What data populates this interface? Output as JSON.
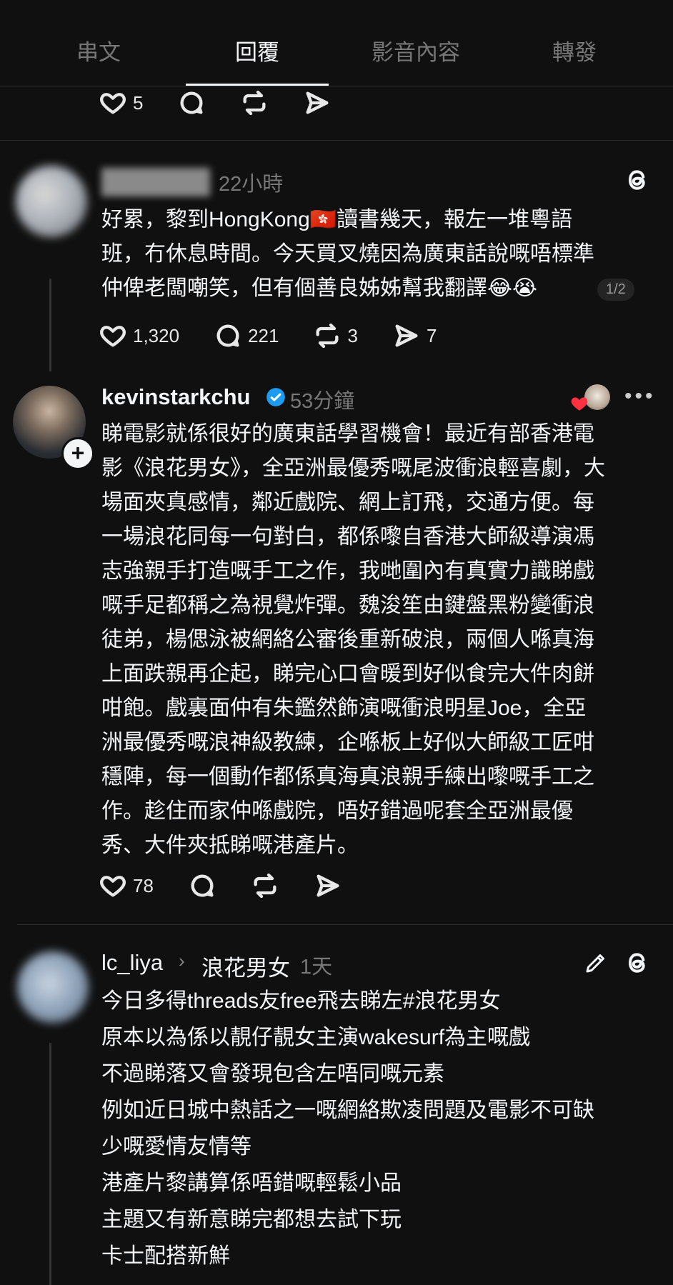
{
  "tabs": [
    "串文",
    "回覆",
    "影音內容",
    "轉發"
  ],
  "top_actions": {
    "likes": "5"
  },
  "post1": {
    "time": "22小時",
    "text": "好累，黎到HongKong🇭🇰讀書幾天，報左一堆粵語\n班，冇休息時間。今天買叉燒因為廣東話說嘅唔標準\n仲俾老闆嘲笑，但有個善良姊姊幫我翻譯😂😭",
    "pager": "1/2",
    "likes": "1,320",
    "replies": "221",
    "reposts": "3",
    "shares": "7"
  },
  "post2": {
    "username": "kevinstarkchu",
    "time": "53分鐘",
    "text": "睇電影就係很好的廣東話學習機會！最近有部香港電\n影《浪花男女》，全亞洲最優秀嘅尾波衝浪輕喜劇，大\n場面夾真感情，鄰近戲院、網上訂飛，交通方便。每\n一場浪花同每一句對白，都係嚟自香港大師級導演馮\n志強親手打造嘅手工之作，我哋圍內有真實力識睇戲\n嘅手足都稱之為視覺炸彈。魏浚笙由鍵盤黑粉變衝浪\n徒弟，楊偲泳被網絡公審後重新破浪，兩個人喺真海\n上面跌親再企起，睇完心口會暖到好似食完大件肉餅\n咁飽。戲裏面仲有朱鑑然飾演嘅衝浪明星Joe，全亞\n洲最優秀嘅浪神級教練，企喺板上好似大師級工匠咁\n穩陣，每一個動作都係真海真浪親手練出嚟嘅手工之\n作。趁住而家仲喺戲院，唔好錯過呢套全亞洲最優\n秀、大件夾抵睇嘅港產片。",
    "likes": "78"
  },
  "post3": {
    "username": "lc_liya",
    "topic": "浪花男女",
    "time": "1天",
    "text": "今日多得threads友free飛去睇左#浪花男女\n原本以為係以靚仔靚女主演wakesurf為主嘅戲\n不過睇落又會發現包含左唔同嘅元素\n例如近日城中熱話之一嘅網絡欺凌問題及電影不可缺\n少嘅愛情友情等\n港產片黎講算係唔錯嘅輕鬆小品\n主題又有新意睇完都想去試下玩\n卡士配搭新鮮"
  },
  "colors": {
    "background": "#101010",
    "text": "#f3f5f7",
    "muted": "#777777",
    "verified": "#1d9bf0"
  }
}
